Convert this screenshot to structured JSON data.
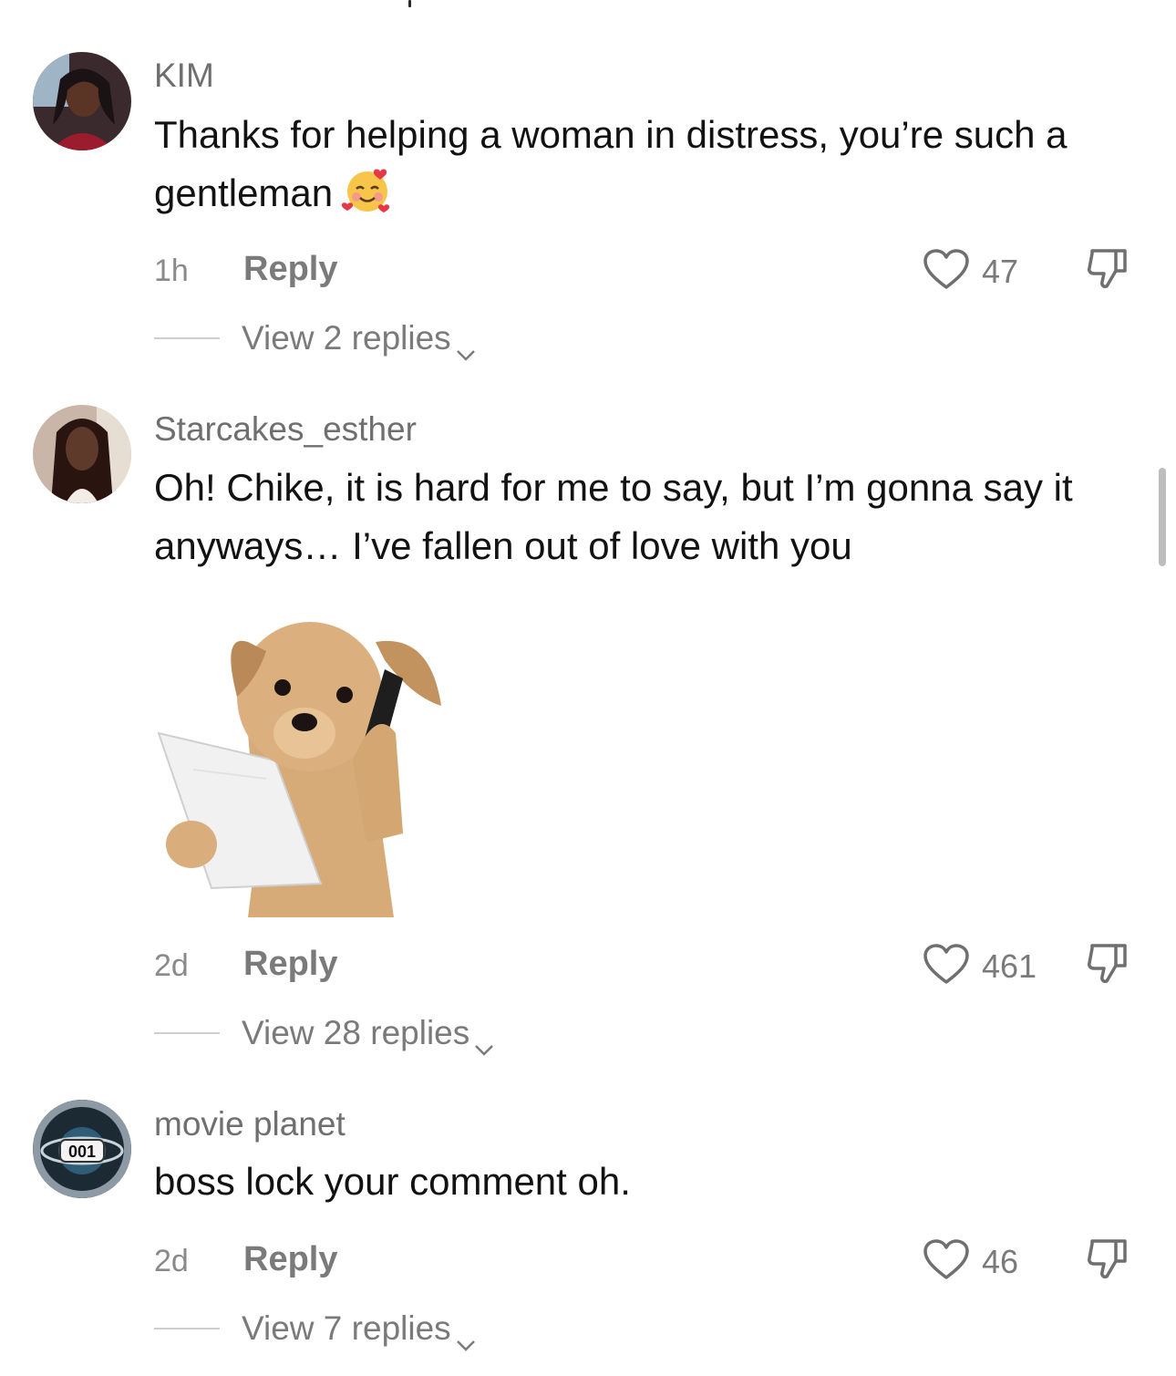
{
  "comments": [
    {
      "username": "KIM",
      "text": "Thanks for helping a woman in distress, you’re such a gentleman",
      "emoji": "smiling-face-with-hearts",
      "time": "1h",
      "reply_label": "Reply",
      "likes": "47",
      "view_replies": "View 2 replies"
    },
    {
      "username": "Starcakes_esther",
      "text": "Oh! Chike, it is hard for me to say, but I’m gonna say it anyways… I’ve fallen out of love with you",
      "attachment": "dog-on-phone-sticker",
      "time": "2d",
      "reply_label": "Reply",
      "likes": "461",
      "view_replies": "View 28 replies"
    },
    {
      "username": "movie planet",
      "text": "boss lock your comment oh.",
      "avatar_logo_text": "001",
      "time": "2d",
      "reply_label": "Reply",
      "likes": "46",
      "view_replies": "View 7 replies"
    }
  ],
  "colors": {
    "username": "#6f6f6f",
    "body_text": "#121212",
    "meta": "#7a7a7a",
    "background": "#ffffff"
  }
}
